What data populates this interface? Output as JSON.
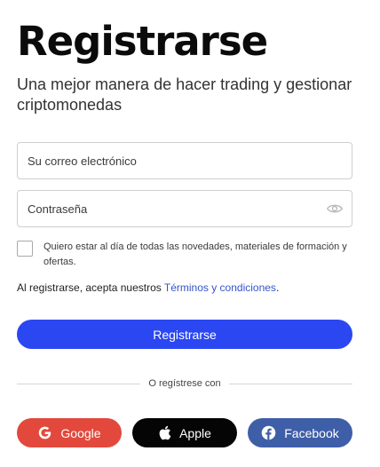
{
  "header": {
    "title": "Registrarse",
    "subtitle": "Una mejor manera de hacer trading y gestionar criptomonedas"
  },
  "form": {
    "email_placeholder": "Su correo electrónico",
    "password_placeholder": "Contraseña",
    "newsletter_label": "Quiero estar al día de todas las novedades, materiales de formación y ofertas.",
    "terms_prefix": "Al registrarse, acepta nuestros ",
    "terms_link": "Términos y condiciones",
    "terms_suffix": ".",
    "submit_label": "Registrarse"
  },
  "social": {
    "divider_text": "O regístrese con",
    "google_label": "Google",
    "apple_label": "Apple",
    "facebook_label": "Facebook"
  },
  "icons": {
    "google": "google-g-icon",
    "apple": "apple-logo-icon",
    "facebook": "facebook-f-icon",
    "password_toggle": "eye-icon"
  },
  "colors": {
    "primary": "#2a47f2",
    "link": "#3653c9",
    "google": "#e2493c",
    "apple": "#050505",
    "facebook": "#3f5ea8"
  }
}
